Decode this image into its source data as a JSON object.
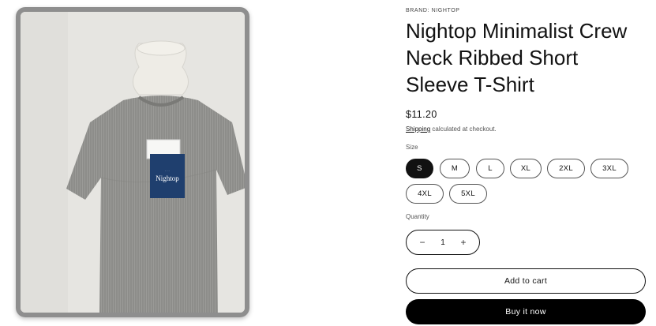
{
  "product": {
    "brand": "BRAND: NIGHTOP",
    "title_lines": [
      "Nightop Minimalist Crew",
      "Neck Ribbed Short",
      "Sleeve T-Shirt"
    ],
    "price": "$11.20",
    "shipping_link": "Shipping",
    "shipping_rest": " calculated at checkout."
  },
  "size": {
    "label": "Size",
    "options": [
      "S",
      "M",
      "L",
      "XL",
      "2XL",
      "3XL",
      "4XL",
      "5XL"
    ],
    "selected": "S"
  },
  "quantity": {
    "label": "Quantity",
    "value": "1",
    "minus": "−",
    "plus": "+"
  },
  "actions": {
    "add_to_cart": "Add to cart",
    "buy_now": "Buy it now"
  },
  "image": {
    "tag_text": "Nightop",
    "colors": {
      "shirt": "#8f8f8c",
      "tag": "#1f3f6e",
      "mannequin": "#e9e7e1"
    }
  }
}
